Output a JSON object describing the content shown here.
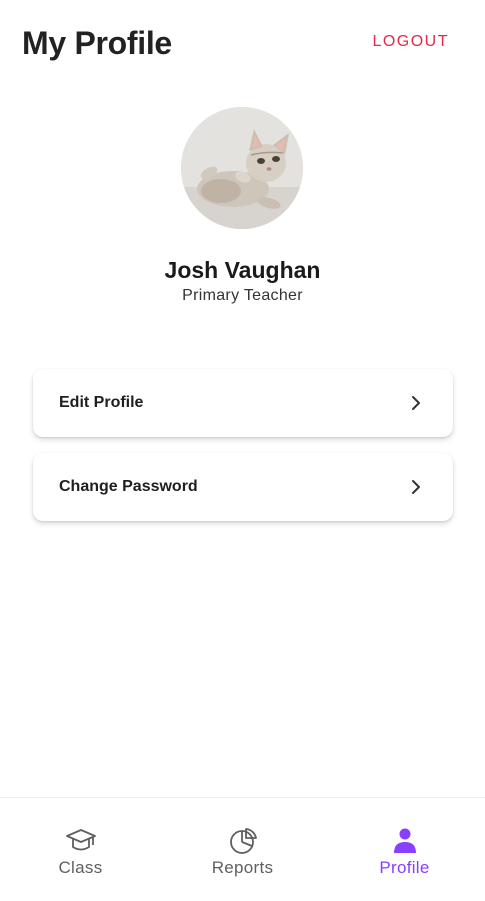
{
  "header": {
    "title": "My Profile",
    "logout_label": "LOGOUT"
  },
  "profile": {
    "name": "Josh Vaughan",
    "role": "Primary Teacher",
    "avatar_icon": "cat-photo"
  },
  "menu": {
    "items": [
      {
        "label": "Edit Profile",
        "icon": "chevron-right-icon"
      },
      {
        "label": "Change Password",
        "icon": "chevron-right-icon"
      }
    ]
  },
  "bottom_nav": {
    "items": [
      {
        "label": "Class",
        "icon": "graduation-cap-icon",
        "active": false
      },
      {
        "label": "Reports",
        "icon": "pie-chart-icon",
        "active": false
      },
      {
        "label": "Profile",
        "icon": "person-icon",
        "active": true
      }
    ],
    "active_color": "#8a3ffc",
    "inactive_color": "#5f5f5f"
  },
  "colors": {
    "logout": "#e02b4a",
    "accent": "#8a3ffc"
  }
}
